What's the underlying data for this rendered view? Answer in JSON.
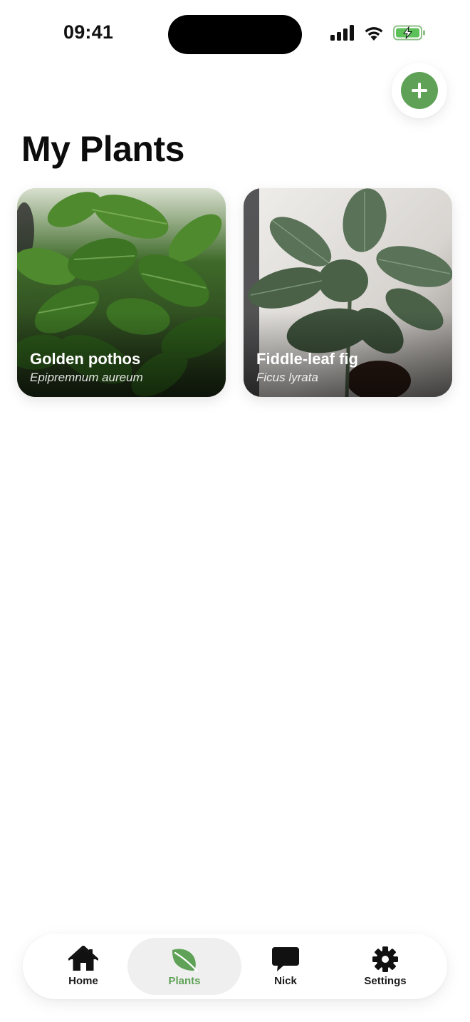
{
  "status_bar": {
    "time": "09:41",
    "icons": [
      "cellular-signal-icon",
      "wifi-icon",
      "battery-charging-icon"
    ]
  },
  "header": {
    "add_icon": "plus-icon",
    "title": "My Plants"
  },
  "plants": [
    {
      "name": "Golden pothos",
      "scientific_name": "Epipremnum aureum"
    },
    {
      "name": "Fiddle-leaf fig",
      "scientific_name": "Ficus lyrata"
    }
  ],
  "tab_bar": {
    "active_tab": "Plants",
    "tabs": [
      {
        "label": "Home",
        "icon": "house-icon"
      },
      {
        "label": "Plants",
        "icon": "leaf-icon"
      },
      {
        "label": "Nick",
        "icon": "chat-bubble-icon"
      },
      {
        "label": "Settings",
        "icon": "gear-icon"
      }
    ]
  },
  "colors": {
    "accent": "#5fa257",
    "active_tab_bg": "#efefef",
    "text": "#111111"
  }
}
